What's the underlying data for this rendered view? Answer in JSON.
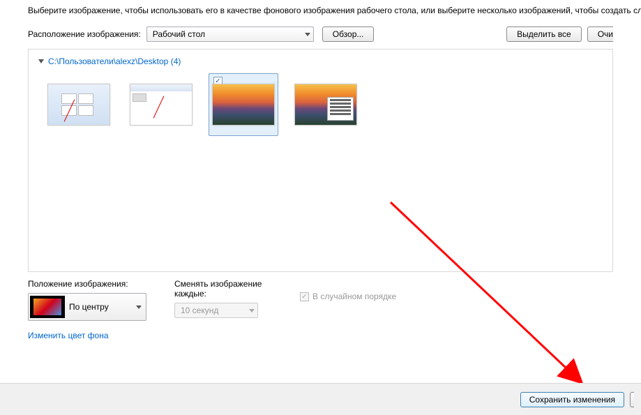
{
  "instruction": "Выберите изображение, чтобы использовать его в качестве фонового изображения рабочего стола, или выберите несколько изображений, чтобы создать сл",
  "location": {
    "label": "Расположение изображения:",
    "value": "Рабочий стол",
    "browse": "Обзор...",
    "select_all": "Выделить все",
    "clear": "Очи"
  },
  "folder_path": "C:\\Пользователи\\alexz\\Desktop (4)",
  "position": {
    "label": "Положение изображения:",
    "value": "По центру"
  },
  "interval": {
    "label": "Сменять изображение каждые:",
    "value": "10 секунд"
  },
  "shuffle": "В случайном порядке",
  "change_bg_color": "Изменить цвет фона",
  "save": "Сохранить изменения"
}
